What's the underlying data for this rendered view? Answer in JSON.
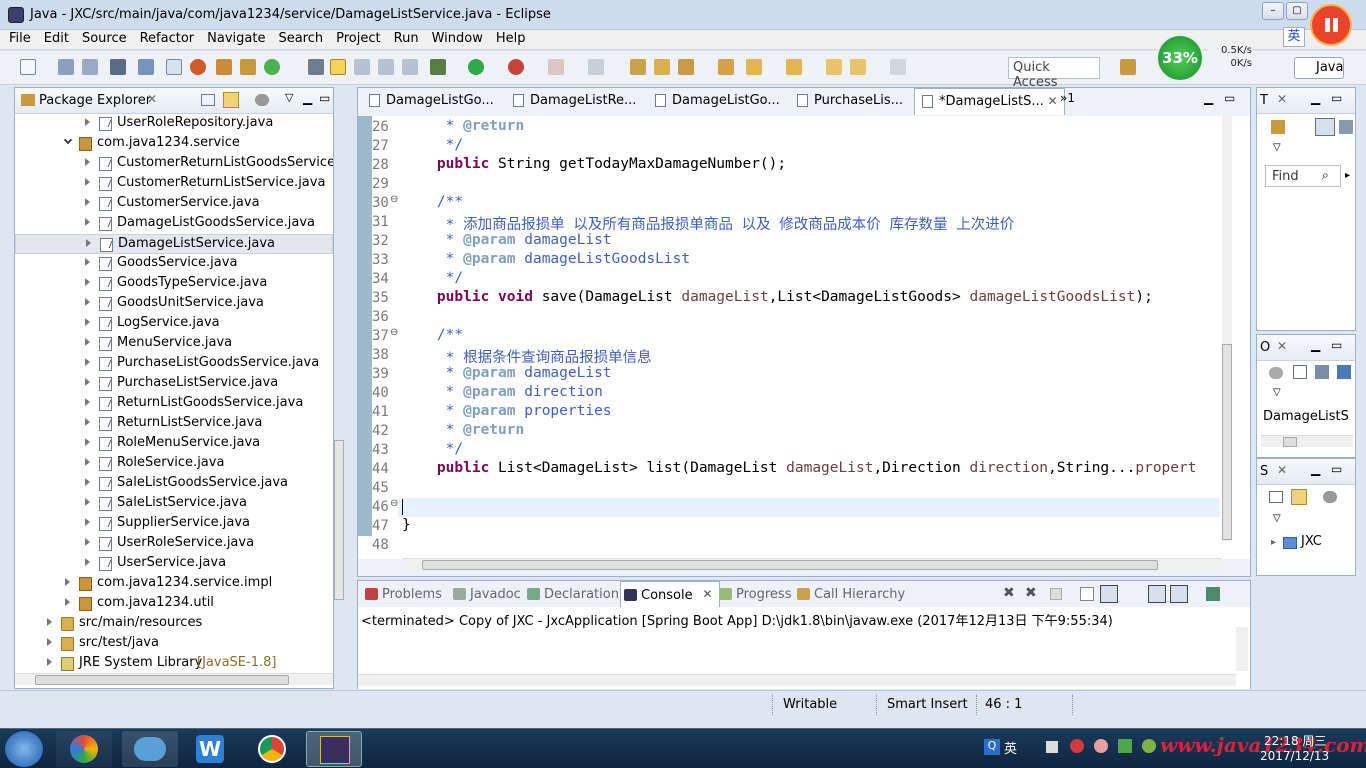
{
  "window": {
    "title": "Java - JXC/src/main/java/com/java1234/service/DamageListService.java - Eclipse"
  },
  "menu": [
    "File",
    "Edit",
    "Source",
    "Refactor",
    "Navigate",
    "Search",
    "Project",
    "Run",
    "Window",
    "Help"
  ],
  "toolbar": {
    "quick_access": "Quick Access",
    "perspective": "Java"
  },
  "speed": {
    "percent": "33%",
    "up": "0.5K/s",
    "down": "0K/s"
  },
  "ime": "英",
  "package_explorer": {
    "title": "Package Explorer",
    "rows": [
      {
        "label": "UserRoleRepository.java",
        "indent": 3,
        "kind": "file",
        "twisty": "closed"
      },
      {
        "label": "com.java1234.service",
        "indent": 2,
        "kind": "pkg",
        "twisty": "open"
      },
      {
        "label": "CustomerReturnListGoodsService.java",
        "indent": 3,
        "kind": "file",
        "twisty": "closed"
      },
      {
        "label": "CustomerReturnListService.java",
        "indent": 3,
        "kind": "file",
        "twisty": "closed"
      },
      {
        "label": "CustomerService.java",
        "indent": 3,
        "kind": "file",
        "twisty": "closed"
      },
      {
        "label": "DamageListGoodsService.java",
        "indent": 3,
        "kind": "file",
        "twisty": "closed"
      },
      {
        "label": "DamageListService.java",
        "indent": 3,
        "kind": "file",
        "twisty": "closed",
        "selected": true
      },
      {
        "label": "GoodsService.java",
        "indent": 3,
        "kind": "file",
        "twisty": "closed"
      },
      {
        "label": "GoodsTypeService.java",
        "indent": 3,
        "kind": "file",
        "twisty": "closed"
      },
      {
        "label": "GoodsUnitService.java",
        "indent": 3,
        "kind": "file",
        "twisty": "closed"
      },
      {
        "label": "LogService.java",
        "indent": 3,
        "kind": "file",
        "twisty": "closed"
      },
      {
        "label": "MenuService.java",
        "indent": 3,
        "kind": "file",
        "twisty": "closed"
      },
      {
        "label": "PurchaseListGoodsService.java",
        "indent": 3,
        "kind": "file",
        "twisty": "closed"
      },
      {
        "label": "PurchaseListService.java",
        "indent": 3,
        "kind": "file",
        "twisty": "closed"
      },
      {
        "label": "ReturnListGoodsService.java",
        "indent": 3,
        "kind": "file",
        "twisty": "closed"
      },
      {
        "label": "ReturnListService.java",
        "indent": 3,
        "kind": "file",
        "twisty": "closed"
      },
      {
        "label": "RoleMenuService.java",
        "indent": 3,
        "kind": "file",
        "twisty": "closed"
      },
      {
        "label": "RoleService.java",
        "indent": 3,
        "kind": "file",
        "twisty": "closed"
      },
      {
        "label": "SaleListGoodsService.java",
        "indent": 3,
        "kind": "file",
        "twisty": "closed"
      },
      {
        "label": "SaleListService.java",
        "indent": 3,
        "kind": "file",
        "twisty": "closed"
      },
      {
        "label": "SupplierService.java",
        "indent": 3,
        "kind": "file",
        "twisty": "closed"
      },
      {
        "label": "UserRoleService.java",
        "indent": 3,
        "kind": "file",
        "twisty": "closed"
      },
      {
        "label": "UserService.java",
        "indent": 3,
        "kind": "file",
        "twisty": "closed"
      },
      {
        "label": "com.java1234.service.impl",
        "indent": 2,
        "kind": "pkg",
        "twisty": "closed"
      },
      {
        "label": "com.java1234.util",
        "indent": 2,
        "kind": "pkg",
        "twisty": "closed"
      },
      {
        "label": "src/main/resources",
        "indent": 1,
        "kind": "fold",
        "twisty": "closed"
      },
      {
        "label": "src/test/java",
        "indent": 1,
        "kind": "fold",
        "twisty": "closed"
      },
      {
        "label": "JRE System Library",
        "suffix": "[JavaSE-1.8]",
        "indent": 1,
        "kind": "lib",
        "twisty": "closed"
      }
    ]
  },
  "editor": {
    "tabs": [
      "DamageListGo...",
      "DamageListRe...",
      "DamageListGo...",
      "PurchaseLis...",
      "*DamageListS..."
    ],
    "overflow": "»1",
    "lines": [
      {
        "n": "26",
        "segs": [
          {
            "t": "     * ",
            "c": "cm"
          },
          {
            "t": "@return",
            "c": "tag"
          }
        ]
      },
      {
        "n": "27",
        "segs": [
          {
            "t": "     */",
            "c": "cm"
          }
        ]
      },
      {
        "n": "28",
        "segs": [
          {
            "t": "    ",
            "c": ""
          },
          {
            "t": "public",
            "c": "kw"
          },
          {
            "t": " String getTodayMaxDamageNumber();",
            "c": ""
          }
        ]
      },
      {
        "n": "29",
        "segs": []
      },
      {
        "n": "30",
        "fold": true,
        "segs": [
          {
            "t": "    /**",
            "c": "cm"
          }
        ]
      },
      {
        "n": "31",
        "segs": [
          {
            "t": "     * 添加商品报损单 以及所有商品报损单商品 以及 修改商品成本价 库存数量 上次进价",
            "c": "cm"
          }
        ]
      },
      {
        "n": "32",
        "segs": [
          {
            "t": "     * ",
            "c": "cm"
          },
          {
            "t": "@param",
            "c": "tag"
          },
          {
            "t": " damageList",
            "c": "cm"
          }
        ]
      },
      {
        "n": "33",
        "segs": [
          {
            "t": "     * ",
            "c": "cm"
          },
          {
            "t": "@param",
            "c": "tag"
          },
          {
            "t": " damageListGoodsList",
            "c": "cm"
          }
        ]
      },
      {
        "n": "34",
        "segs": [
          {
            "t": "     */",
            "c": "cm"
          }
        ]
      },
      {
        "n": "35",
        "segs": [
          {
            "t": "    ",
            "c": ""
          },
          {
            "t": "public",
            "c": "kw"
          },
          {
            "t": " ",
            "c": ""
          },
          {
            "t": "void",
            "c": "kw"
          },
          {
            "t": " save(DamageList ",
            "c": ""
          },
          {
            "t": "damageList",
            "c": "pv"
          },
          {
            "t": ",List<DamageListGoods> ",
            "c": ""
          },
          {
            "t": "damageListGoodsList",
            "c": "pv"
          },
          {
            "t": ");",
            "c": ""
          }
        ]
      },
      {
        "n": "36",
        "segs": []
      },
      {
        "n": "37",
        "fold": true,
        "segs": [
          {
            "t": "    /**",
            "c": "cm"
          }
        ]
      },
      {
        "n": "38",
        "segs": [
          {
            "t": "     * 根据条件查询商品报损单信息",
            "c": "cm"
          }
        ]
      },
      {
        "n": "39",
        "segs": [
          {
            "t": "     * ",
            "c": "cm"
          },
          {
            "t": "@param",
            "c": "tag"
          },
          {
            "t": " damageList",
            "c": "cm"
          }
        ]
      },
      {
        "n": "40",
        "segs": [
          {
            "t": "     * ",
            "c": "cm"
          },
          {
            "t": "@param",
            "c": "tag"
          },
          {
            "t": " direction",
            "c": "cm"
          }
        ]
      },
      {
        "n": "41",
        "segs": [
          {
            "t": "     * ",
            "c": "cm"
          },
          {
            "t": "@param",
            "c": "tag"
          },
          {
            "t": " properties",
            "c": "cm"
          }
        ]
      },
      {
        "n": "42",
        "segs": [
          {
            "t": "     * ",
            "c": "cm"
          },
          {
            "t": "@return",
            "c": "tag"
          }
        ]
      },
      {
        "n": "43",
        "segs": [
          {
            "t": "     */",
            "c": "cm"
          }
        ]
      },
      {
        "n": "44",
        "segs": [
          {
            "t": "    ",
            "c": ""
          },
          {
            "t": "public",
            "c": "kw"
          },
          {
            "t": " List<DamageList> list(DamageList ",
            "c": ""
          },
          {
            "t": "damageList",
            "c": "pv"
          },
          {
            "t": ",Direction ",
            "c": ""
          },
          {
            "t": "direction",
            "c": "pv"
          },
          {
            "t": ",String...",
            "c": ""
          },
          {
            "t": "propert",
            "c": "pv"
          }
        ]
      },
      {
        "n": "45",
        "segs": []
      },
      {
        "n": "46",
        "fold": true,
        "current": true,
        "segs": []
      },
      {
        "n": "47",
        "segs": [
          {
            "t": "}",
            "c": ""
          }
        ]
      },
      {
        "n": "48",
        "segs": []
      }
    ]
  },
  "console": {
    "tabs": [
      "Problems",
      "Javadoc",
      "Declaration",
      "Console",
      "Progress",
      "Call Hierarchy"
    ],
    "active": "Console",
    "text": "<terminated> Copy of JXC - JxcApplication [Spring Boot App] D:\\jdk1.8\\bin\\javaw.exe (2017年12月13日 下午9:55:34)"
  },
  "right": {
    "a_title": "T",
    "find": "Find",
    "b_title": "O",
    "b_item": "DamageListS",
    "c_title": "S",
    "c_item": "JXC"
  },
  "status": {
    "writable": "Writable",
    "insert": "Smart Insert",
    "pos": "46 : 1"
  },
  "taskbar": {
    "time": "22:18 周三",
    "date": "2017/12/13",
    "ime": "英",
    "watermark": "www.java1234.com"
  }
}
